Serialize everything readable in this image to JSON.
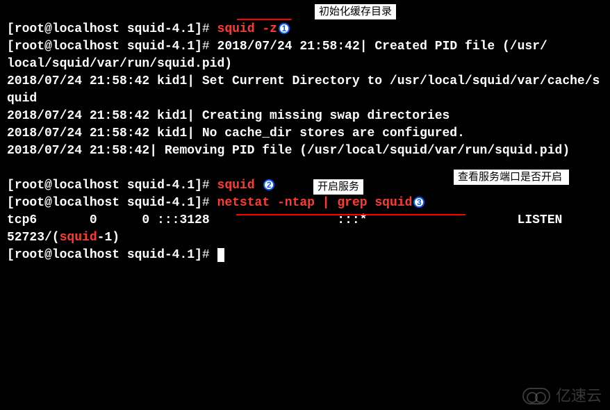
{
  "prompt": {
    "user": "root",
    "host": "localhost",
    "dir": "squid-4.1",
    "symbol": "#"
  },
  "commands": {
    "cmd1": "squid -z",
    "cmd2": "squid",
    "cmd3": "netstat -ntap | grep squid"
  },
  "output": {
    "ts_line1_prefix": "2018/07/24 21:58:42| Created PID file (/usr/",
    "ts_line1_suffix": "local/squid/var/run/squid.pid)",
    "line_setdir": "2018/07/24 21:58:42 kid1| Set Current Directory to /usr/local/squid/var/cache/squid",
    "line_creating": "2018/07/24 21:58:42 kid1| Creating missing swap directories",
    "line_nocache": "2018/07/24 21:58:42 kid1| No cache_dir stores are configured.",
    "line_removing": "2018/07/24 21:58:42| Removing PID file (/usr/local/squid/var/run/squid.pid)",
    "netstat_pre": "tcp6       0      0 :::3128                 :::*                    LISTEN      52723/(",
    "netstat_proc": "squid",
    "netstat_post": "-1)"
  },
  "annotations": {
    "b1": "1",
    "b2": "2",
    "b3": "3",
    "label1": "初始化缓存目录",
    "label2": "开启服务",
    "label3": "查看服务端口是否开启"
  },
  "watermark": "亿速云",
  "colors": {
    "bullet": "#0a5cff",
    "red_text": "#ff3b30",
    "redline": "#ff0000"
  }
}
